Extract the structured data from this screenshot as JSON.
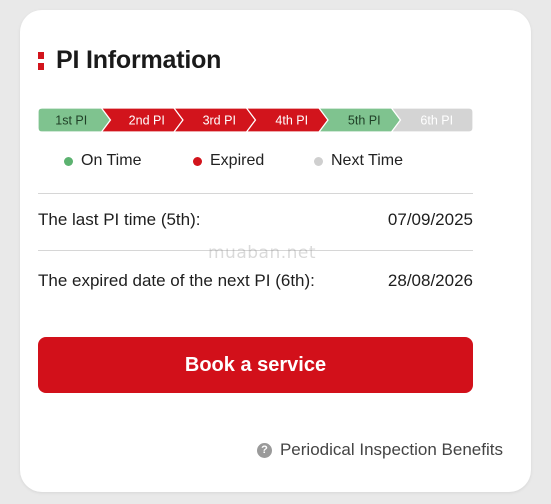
{
  "card": {
    "title": "PI Information"
  },
  "stepper": {
    "steps": [
      {
        "label": "1st PI",
        "status": "on_time"
      },
      {
        "label": "2nd PI",
        "status": "expired"
      },
      {
        "label": "3rd PI",
        "status": "expired"
      },
      {
        "label": "4th PI",
        "status": "expired"
      },
      {
        "label": "5th PI",
        "status": "on_time"
      },
      {
        "label": "6th PI",
        "status": "next_time"
      }
    ]
  },
  "legend": {
    "on_time": "On Time",
    "expired": "Expired",
    "next_time": "Next Time"
  },
  "colors": {
    "on_time": "#7fc38f",
    "expired": "#d2141c",
    "next_time": "#d4d4d4",
    "on_time_dot": "#5cb270",
    "next_time_dot": "#cfcfcf"
  },
  "info": {
    "last_pi_label": "The last PI time (5th):",
    "last_pi_value": "07/09/2025",
    "next_pi_label": "The expired date of the next PI (6th):",
    "next_pi_value": "28/08/2026"
  },
  "watermark": "muaban.net",
  "actions": {
    "book_service": "Book a service",
    "benefits_link": "Periodical Inspection Benefits",
    "help_glyph": "?"
  }
}
